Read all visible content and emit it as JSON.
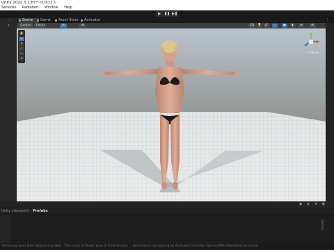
{
  "window": {
    "title": "Unity 2022.3.13f1* <DX11>",
    "menus": [
      "Services",
      "Radiation",
      "Window",
      "Help"
    ]
  },
  "play_controls": [
    "▶",
    "❚❚",
    "▶❚"
  ],
  "tabs": [
    {
      "label": "Scene",
      "active": true
    },
    {
      "label": "Game",
      "active": false
    },
    {
      "label": "Asset Store",
      "active": false
    },
    {
      "label": "Animator",
      "active": false
    }
  ],
  "scene_toolbar": {
    "left_buttons": [
      "Center",
      "Local",
      "⊞",
      "⊞"
    ],
    "right_buttons": [
      "2D",
      "💡",
      "🔊",
      "◇",
      "●",
      "◐",
      "⊕",
      "⊞"
    ]
  },
  "tool_palette": [
    "✋",
    "✥",
    "↻",
    "⤢",
    "▭",
    "⊕"
  ],
  "gizmo": {
    "label": "< Persp"
  },
  "project": {
    "breadcrumb_prefix": "Unity classes(3)",
    "breadcrumb_current": "Prefabs"
  },
  "status_text": "Removing Seed Jitter Boomerang Wait - The script of Tween type of OnNext(null) … Animator is not playing an AnimatorController (SkinnedMeshRenderer) in Scene"
}
